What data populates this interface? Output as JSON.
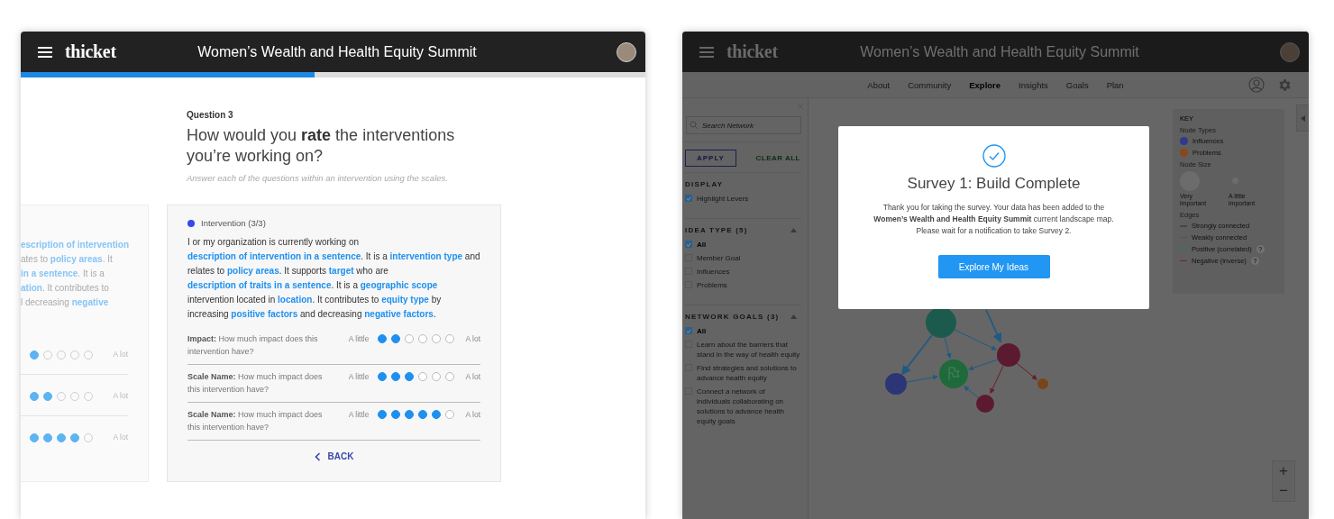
{
  "left_window": {
    "header": {
      "logo": "thicket",
      "title": "Women’s Wealth and Health Equity Summit"
    },
    "progress": {
      "level": 0.47
    },
    "question": {
      "number": "Question 3",
      "title": "How would you **rate** the interventions you’re working on?",
      "hint": "Answer each of the questions within an intervention using the scales."
    },
    "previous_card": {
      "lines": [
        [
          {
            "kind": "link",
            "text": "escription of intervention"
          }
        ],
        [
          {
            "kind": "text",
            "text": "ates to "
          },
          {
            "kind": "link",
            "text": "policy areas"
          },
          {
            "kind": "text",
            "text": ". It"
          }
        ],
        [
          {
            "kind": "link",
            "text": "in a sentence"
          },
          {
            "kind": "text",
            "text": ". It is a"
          }
        ],
        [
          {
            "kind": "link",
            "text": "ation"
          },
          {
            "kind": "text",
            "text": ". It contributes to"
          }
        ],
        [
          {
            "kind": "text",
            "text": "l decreasing "
          },
          {
            "kind": "link",
            "text": "negative"
          }
        ]
      ],
      "scales": [
        {
          "stars": 1,
          "high_label": "A lot"
        },
        {
          "stars": 2,
          "high_label": "A lot"
        },
        {
          "stars": 4,
          "high_label": "A lot"
        }
      ]
    },
    "card": {
      "label": "Intervention (3/3)",
      "sentence": [
        {
          "kind": "text",
          "text": "I or my organization is currently working on "
        },
        {
          "kind": "link",
          "text": "description of intervention in a sentence"
        },
        {
          "kind": "text",
          "text": ". It is a "
        },
        {
          "kind": "link",
          "text": "intervention type"
        },
        {
          "kind": "text",
          "text": " and relates to "
        },
        {
          "kind": "link",
          "text": "policy areas"
        },
        {
          "kind": "text",
          "text": ". It supports "
        },
        {
          "kind": "link",
          "text": "target"
        },
        {
          "kind": "text",
          "text": " who are "
        },
        {
          "kind": "link",
          "text": "description of traits in a sentence"
        },
        {
          "kind": "text",
          "text": ". It is a "
        },
        {
          "kind": "link",
          "text": "geographic scope"
        },
        {
          "kind": "text",
          "text": " intervention located in "
        },
        {
          "kind": "link",
          "text": "location"
        },
        {
          "kind": "text",
          "text": ". It contributes to "
        },
        {
          "kind": "link",
          "text": "equity type"
        },
        {
          "kind": "text",
          "text": " by increasing "
        },
        {
          "kind": "link",
          "text": "positive factors"
        },
        {
          "kind": "text",
          "text": " and decreasing "
        },
        {
          "kind": "link",
          "text": "negative factors"
        },
        {
          "kind": "text",
          "text": "."
        }
      ],
      "scales": [
        {
          "name": "Impact:",
          "question": "How much impact does this intervention have?",
          "low_label": "A little",
          "stars": 2,
          "high_label": "A lot"
        },
        {
          "name": "Scale Name:",
          "question": "How much impact does this intervention have?",
          "low_label": "A little",
          "stars": 3,
          "high_label": "A lot"
        },
        {
          "name": "Scale Name:",
          "question": "How much impact does this intervention have?",
          "low_label": "A little",
          "stars": 5,
          "high_label": "A lot"
        }
      ],
      "back_button": "BACK"
    }
  },
  "right_window": {
    "header": {
      "logo": "thicket",
      "title": "Women’s Wealth and Health Equity Summit"
    },
    "nav": [
      {
        "label": "About",
        "selected": false
      },
      {
        "label": "Community",
        "selected": false
      },
      {
        "label": "Explore",
        "selected": true
      },
      {
        "label": "Insights",
        "selected": false
      },
      {
        "label": "Goals",
        "selected": false
      },
      {
        "label": "Plan",
        "selected": false
      }
    ],
    "sidebar": {
      "search": {
        "placeholder": "Search Network"
      },
      "apply_button": "APPLY",
      "clear_button": "CLEAR ALL",
      "sections": [
        {
          "title": "DISPLAY",
          "options": [
            {
              "label": "Highlight Levers",
              "kind": "item",
              "checked": true
            }
          ]
        },
        {
          "title": "IDEA TYPE (5)",
          "expanded": true,
          "options": [
            {
              "label": "All",
              "kind": "all",
              "checked": true
            },
            {
              "label": "Member Goal",
              "kind": "item",
              "checked": false
            },
            {
              "label": "Influences",
              "kind": "item",
              "checked": false
            },
            {
              "label": "Problems",
              "kind": "item",
              "checked": false
            }
          ]
        },
        {
          "title": "NETWORK GOALS (3)",
          "expanded": true,
          "options": [
            {
              "label": "All",
              "kind": "all",
              "checked": true
            },
            {
              "label": "Learn about the barriers that stand in the way of health equity",
              "kind": "item",
              "checked": false
            },
            {
              "label": "Find strategies and solutions to advance health equity",
              "kind": "item",
              "checked": false
            },
            {
              "label": "Connect a network of individuals collaborating on solutions to advance health equity goals",
              "kind": "item",
              "checked": false
            }
          ]
        }
      ]
    },
    "key": {
      "title": "KEY",
      "node_types_title": "Node Types",
      "node_types": [
        {
          "label": "Influences",
          "color": "#2f3a8c"
        },
        {
          "label": "Problems",
          "color": "#8a4719"
        }
      ],
      "node_size_title": "Node Size",
      "node_sizes": [
        {
          "label": "Very important",
          "kind": "large"
        },
        {
          "label": "A little important",
          "kind": "small"
        }
      ],
      "edges_title": "Edges",
      "edges": [
        {
          "label": "Strongly connected",
          "kind": "strong",
          "color": "#454545"
        },
        {
          "label": "Weakly connected",
          "kind": "weak",
          "color": "#545454"
        },
        {
          "label": "Positive (correlated)",
          "kind": "weak",
          "color": "#1f8050",
          "help": "?"
        },
        {
          "label": "Negative (inverse)",
          "kind": "weak",
          "color": "#7e1f2c",
          "help": "?"
        }
      ]
    },
    "modal": {
      "title": "Survey 1: Build Complete",
      "message": "Thank you for taking the survey. Your data has been added to the **Women’s Wealth and Health Equity Summit** current landscape map. Please wait for a notification to take Survey 2.",
      "button": "Explore My Ideas"
    },
    "zoom": {
      "plus": "+",
      "minus": "−"
    }
  }
}
